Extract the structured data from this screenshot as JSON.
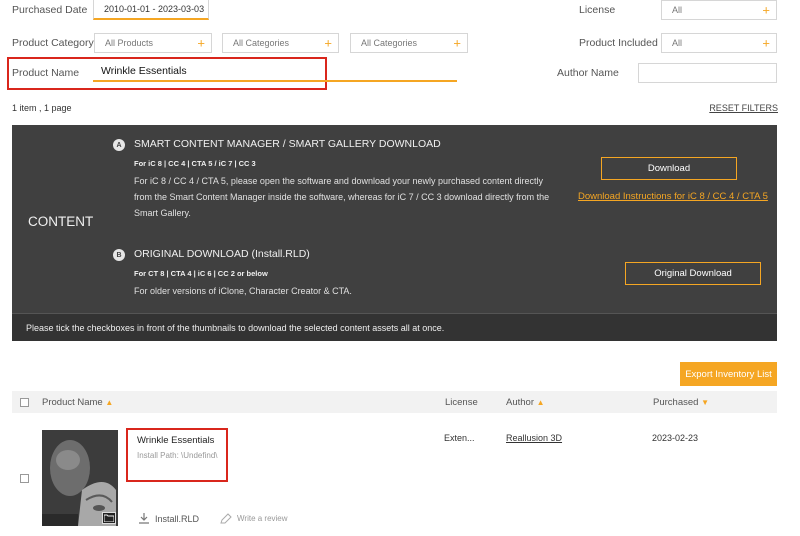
{
  "filters": {
    "purchased_date_label": "Purchased Date",
    "date_range": "2010-01-01 - 2023-03-03",
    "license_label": "License",
    "license_value": "All",
    "product_category_label": "Product Category",
    "product_category_value": "All Products",
    "category2_value": "All Categories",
    "category3_value": "All Categories",
    "product_included_label": "Product Included",
    "product_included_value": "All",
    "product_name_label": "Product Name",
    "product_name_value": "Wrinkle Essentials",
    "author_name_label": "Author Name",
    "author_name_value": ""
  },
  "results": {
    "count_text": "1 item , 1 page",
    "reset_label": "RESET FILTERS"
  },
  "content_panel": {
    "heading": "CONTENT",
    "option_a": {
      "badge": "A",
      "title": "SMART CONTENT MANAGER / SMART GALLERY DOWNLOAD",
      "subtitle": "For iC 8 | CC 4 | CTA 5 / iC 7 | CC 3",
      "desc1": "For iC 8 / CC 4 / CTA 5, please open the software and download your newly purchased content directly",
      "desc2": "from the Smart Content Manager inside the software, whereas for iC 7 / CC 3 download directly from the",
      "desc3": "Smart Gallery.",
      "button": "Download",
      "link": "Download Instructions for iC 8 / CC 4 / CTA 5"
    },
    "option_b": {
      "badge": "B",
      "title": "ORIGINAL DOWNLOAD (Install.RLD)",
      "subtitle": "For CT 8 | CTA 4 | iC 6 | CC 2 or below",
      "desc": "For older versions of iClone, Character Creator & CTA.",
      "button": "Original Download"
    },
    "notice": "Please tick the checkboxes in front of the thumbnails to download the selected content assets all at once."
  },
  "export_label": "Export Inventory List",
  "table": {
    "headers": {
      "product_name": "Product Name",
      "license": "License",
      "author": "Author",
      "purchased": "Purchased"
    },
    "rows": [
      {
        "name": "Wrinkle Essentials",
        "install_path": "Install Path: \\Undefind\\",
        "license": "Exten...",
        "author": "Reallusion 3D",
        "purchased": "2023-02-23",
        "install_label": "Install.RLD",
        "review_label": "Write a review"
      }
    ]
  },
  "colors": {
    "accent": "#f5a623",
    "panel": "#404040",
    "highlight": "#d9261c"
  }
}
